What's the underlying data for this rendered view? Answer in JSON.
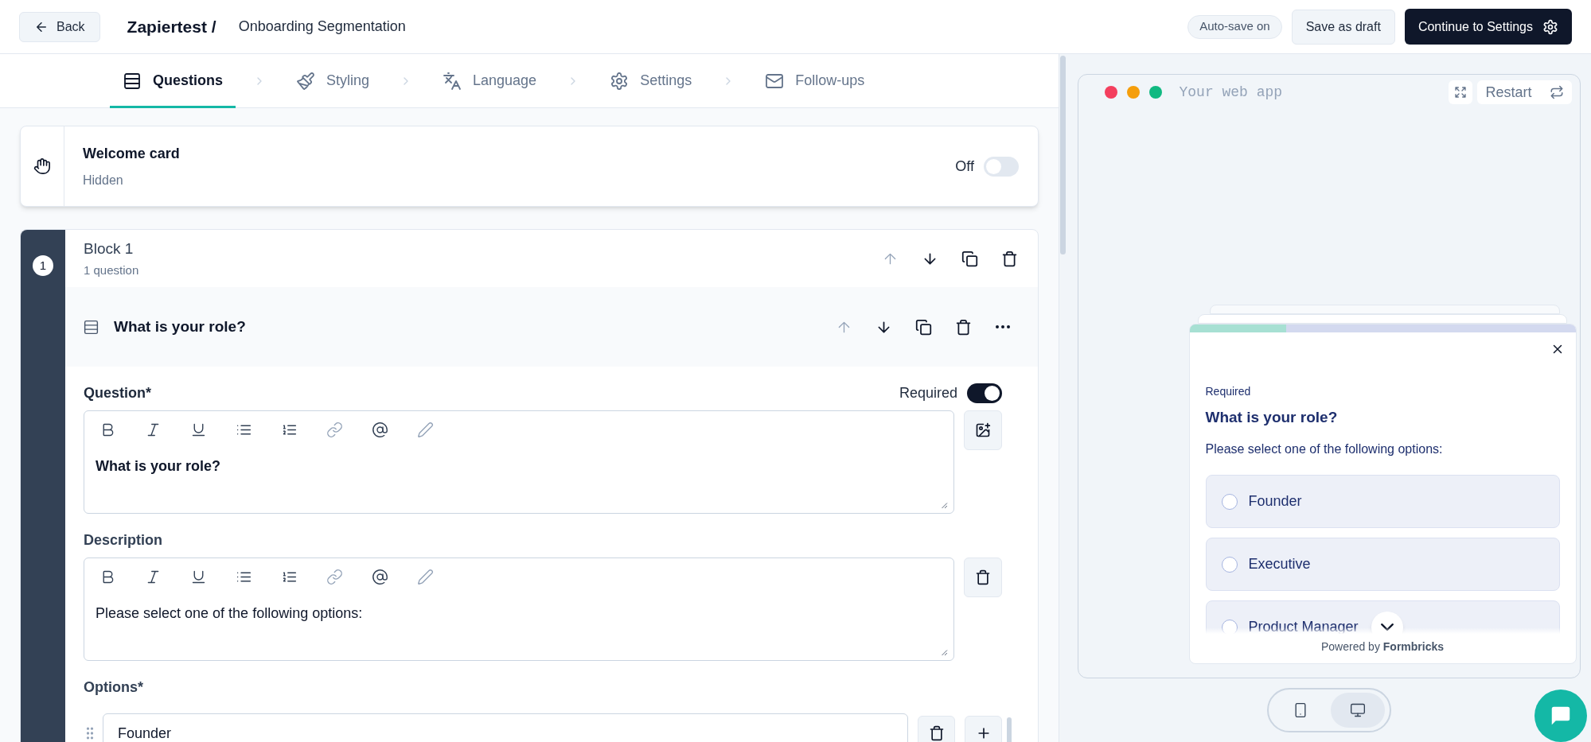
{
  "header": {
    "back": "Back",
    "project": "Zapiertest /",
    "survey_name": "Onboarding Segmentation",
    "autosave": "Auto-save on",
    "save_draft": "Save as draft",
    "continue": "Continue to Settings"
  },
  "tabs": [
    {
      "label": "Questions",
      "kind": "questions",
      "selected": true
    },
    {
      "label": "Styling",
      "kind": "styling",
      "selected": false
    },
    {
      "label": "Language",
      "kind": "language",
      "selected": false
    },
    {
      "label": "Settings",
      "kind": "settings",
      "selected": false
    },
    {
      "label": "Follow-ups",
      "kind": "followups",
      "selected": false
    }
  ],
  "welcome_card": {
    "title": "Welcome card",
    "status": "Hidden",
    "toggle_label": "Off",
    "on": false
  },
  "block": {
    "number": "1",
    "title": "Block 1",
    "subtitle": "1 question",
    "actions": [
      {
        "kind": "up",
        "disabled": true
      },
      {
        "kind": "down",
        "disabled": false
      },
      {
        "kind": "copy",
        "disabled": false
      },
      {
        "kind": "trash",
        "disabled": false
      }
    ],
    "question": {
      "title": "What is your role?",
      "actions": [
        {
          "kind": "up",
          "disabled": true
        },
        {
          "kind": "down",
          "disabled": false
        },
        {
          "kind": "copy",
          "disabled": false
        },
        {
          "kind": "trash",
          "disabled": false
        },
        {
          "kind": "more",
          "disabled": false
        }
      ],
      "question_label": "Question*",
      "required_label": "Required",
      "required": true,
      "question_text": "What is your role?",
      "description_label": "Description",
      "description_text": "Please select one of the following options:",
      "options_label": "Options*",
      "options": [
        {
          "value": "Founder"
        }
      ]
    }
  },
  "editor_tools": [
    {
      "kind": "bold",
      "disabled": false
    },
    {
      "kind": "italic",
      "disabled": false
    },
    {
      "kind": "underline",
      "disabled": false
    },
    {
      "kind": "bullets",
      "disabled": false
    },
    {
      "kind": "numbers",
      "disabled": false
    },
    {
      "kind": "link",
      "disabled": true
    },
    {
      "kind": "at",
      "disabled": false
    },
    {
      "kind": "pencil",
      "disabled": true
    }
  ],
  "preview": {
    "app_label": "Your web app",
    "restart": "Restart",
    "survey": {
      "level": 0.25,
      "required": "Required",
      "title": "What is your role?",
      "description": "Please select one of the following options:",
      "choices": [
        {
          "label": "Founder",
          "selected": false
        },
        {
          "label": "Executive",
          "selected": false
        },
        {
          "label": "Product Manager",
          "selected": false
        }
      ],
      "footer": "Powered by **Formbricks**"
    },
    "devices": [
      {
        "kind": "phone",
        "selected": false
      },
      {
        "kind": "desktop",
        "selected": true
      }
    ]
  }
}
